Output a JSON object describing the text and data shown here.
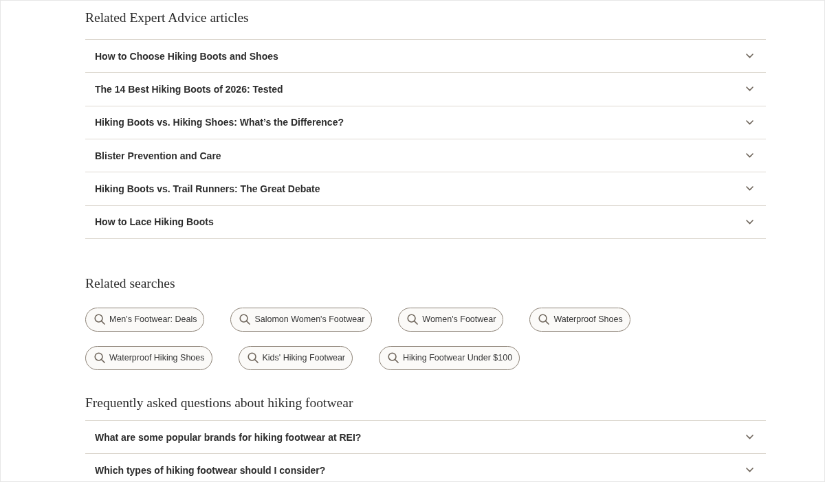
{
  "expert_advice": {
    "title": "Related Expert Advice articles",
    "items": [
      {
        "label": "How to Choose Hiking Boots and Shoes",
        "expanded": false
      },
      {
        "label": "The 14 Best Hiking Boots of 2026: Tested",
        "expanded": false
      },
      {
        "label": "Hiking Boots vs. Hiking Shoes: What’s the Difference?",
        "expanded": false
      },
      {
        "label": "Blister Prevention and Care",
        "expanded": false
      },
      {
        "label": "Hiking Boots vs. Trail Runners: The Great Debate",
        "expanded": false
      },
      {
        "label": "How to Lace Hiking Boots",
        "expanded": false
      }
    ]
  },
  "related_searches": {
    "title": "Related searches",
    "chips": [
      "Men's Footwear: Deals",
      "Salomon Women's Footwear",
      "Women's Footwear",
      "Waterproof Shoes",
      "Waterproof Hiking Shoes",
      "Kids' Hiking Footwear",
      "Hiking Footwear Under $100"
    ]
  },
  "faq": {
    "title": "Frequently asked questions about hiking footwear",
    "items": [
      {
        "label": "What are some popular brands for hiking footwear at REI?",
        "expanded": false
      },
      {
        "label": "Which types of hiking footwear should I consider?",
        "expanded": false
      }
    ]
  }
}
